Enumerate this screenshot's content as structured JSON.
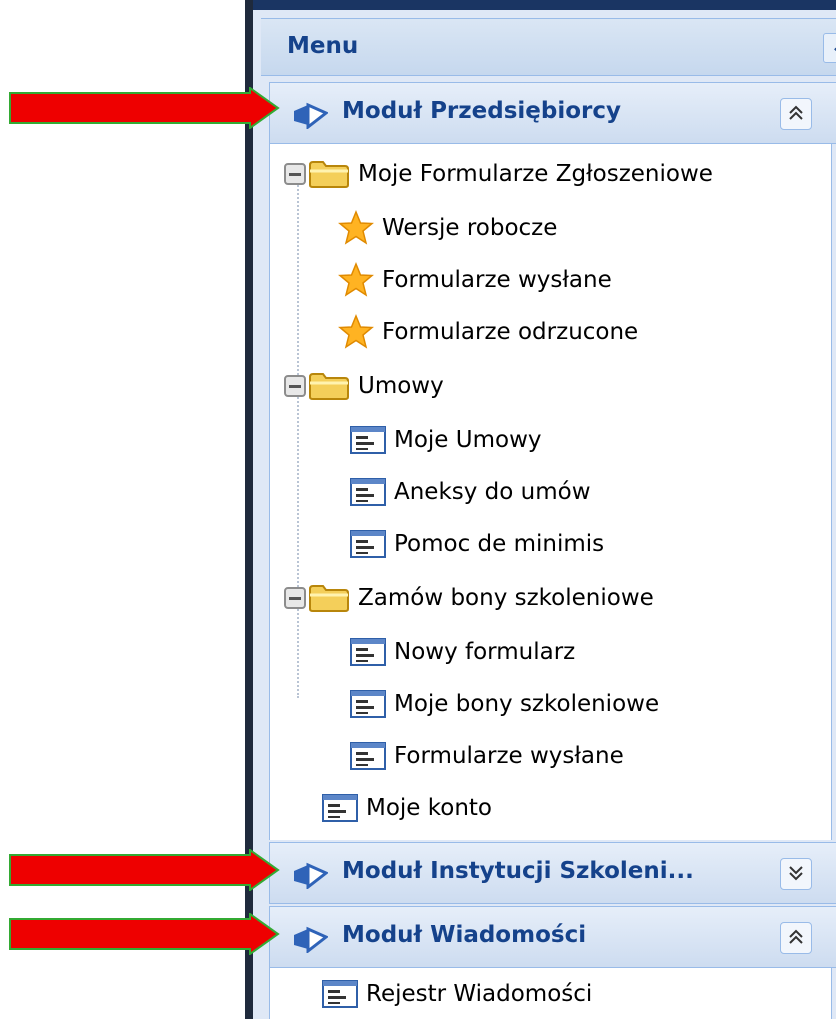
{
  "menu": {
    "title": "Menu",
    "collapse_icon": "chevron-left-icon"
  },
  "sections": [
    {
      "title": "Moduł Przedsiębiorcy",
      "toggle_icon": "double-chevron-up-icon",
      "expanded": true,
      "tree": [
        {
          "label": "Moje Formularze Zgłoszeniowe",
          "icon": "folder-icon",
          "children": [
            {
              "label": "Wersje robocze",
              "icon": "star-icon"
            },
            {
              "label": "Formularze wysłane",
              "icon": "star-icon"
            },
            {
              "label": "Formularze odrzucone",
              "icon": "star-icon"
            }
          ]
        },
        {
          "label": "Umowy",
          "icon": "folder-icon",
          "children": [
            {
              "label": "Moje Umowy",
              "icon": "form-icon"
            },
            {
              "label": "Aneksy do umów",
              "icon": "form-icon"
            },
            {
              "label": "Pomoc de minimis",
              "icon": "form-icon"
            }
          ]
        },
        {
          "label": "Zamów bony szkoleniowe",
          "icon": "folder-icon",
          "children": [
            {
              "label": "Nowy formularz",
              "icon": "form-icon"
            },
            {
              "label": "Moje bony szkoleniowe",
              "icon": "form-icon"
            },
            {
              "label": "Formularze wysłane",
              "icon": "form-icon"
            }
          ]
        },
        {
          "label": "Moje konto",
          "icon": "form-icon"
        }
      ]
    },
    {
      "title": "Moduł Instytucji Szkoleni...",
      "toggle_icon": "double-chevron-down-icon",
      "expanded": false
    },
    {
      "title": "Moduł Wiadomości",
      "toggle_icon": "double-chevron-up-icon",
      "expanded": true,
      "tree": [
        {
          "label": "Rejestr Wiadomości",
          "icon": "form-icon"
        }
      ]
    }
  ],
  "annotations": {
    "arrow_color": "#ee0000",
    "arrow_border": "#33aa33",
    "arrow_icon": "red-arrow-icon"
  },
  "colors": {
    "header_text": "#15428b",
    "panel_border": "#99bbe8",
    "dark_frame": "#1f2a3c"
  }
}
